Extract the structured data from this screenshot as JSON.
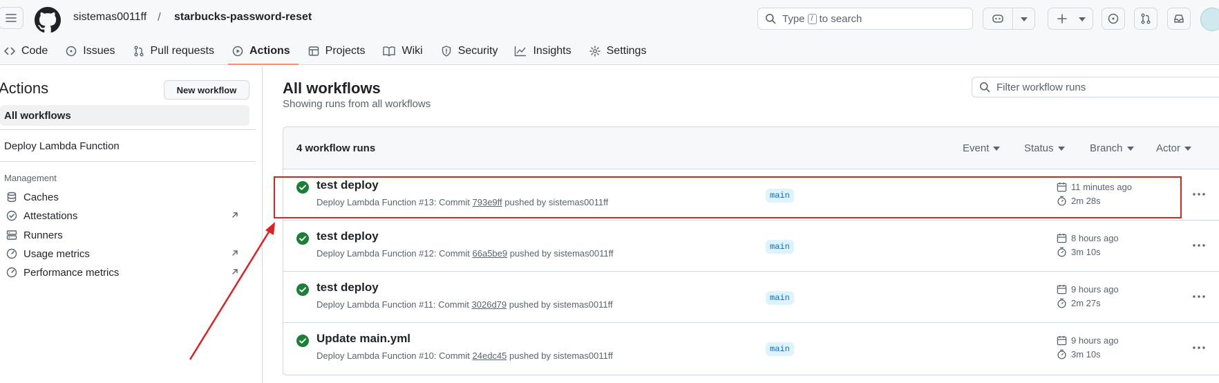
{
  "header": {
    "owner": "sistemas0011ff",
    "separator": "/",
    "repo": "starbucks-password-reset",
    "search": {
      "prefix": "Type",
      "key": "/",
      "suffix": "to search"
    }
  },
  "repo_nav": {
    "tabs": [
      {
        "label": "Code",
        "icon": "code-icon"
      },
      {
        "label": "Issues",
        "icon": "issue-opened-icon"
      },
      {
        "label": "Pull requests",
        "icon": "git-pull-request-icon"
      },
      {
        "label": "Actions",
        "icon": "play-icon",
        "active": true
      },
      {
        "label": "Projects",
        "icon": "table-icon"
      },
      {
        "label": "Wiki",
        "icon": "book-icon"
      },
      {
        "label": "Security",
        "icon": "shield-icon"
      },
      {
        "label": "Insights",
        "icon": "graph-icon"
      },
      {
        "label": "Settings",
        "icon": "gear-icon"
      }
    ]
  },
  "sidebar": {
    "title": "Actions",
    "new_workflow": "New workflow",
    "all_workflows": "All workflows",
    "workflows": [
      "Deploy Lambda Function"
    ],
    "management_heading": "Management",
    "management": [
      {
        "label": "Caches",
        "icon": "database-icon",
        "external": false
      },
      {
        "label": "Attestations",
        "icon": "verified-icon",
        "external": true
      },
      {
        "label": "Runners",
        "icon": "server-icon",
        "external": false
      },
      {
        "label": "Usage metrics",
        "icon": "meter-icon",
        "external": true
      },
      {
        "label": "Performance metrics",
        "icon": "meter-icon",
        "external": true
      }
    ]
  },
  "main": {
    "title": "All workflows",
    "subtitle": "Showing runs from all workflows",
    "filter_placeholder": "Filter workflow runs",
    "run_count": "4 workflow runs",
    "filters": [
      "Event",
      "Status",
      "Branch",
      "Actor"
    ],
    "runs": [
      {
        "title": "test deploy",
        "workflow": "Deploy Lambda Function",
        "number": "#13",
        "commit_label": "Commit",
        "sha": "793e9ff",
        "pushed_by": "pushed by sistemas0011ff",
        "branch": "main",
        "when": "11 minutes ago",
        "duration": "2m 28s",
        "status": "success"
      },
      {
        "title": "test deploy",
        "workflow": "Deploy Lambda Function",
        "number": "#12",
        "commit_label": "Commit",
        "sha": "66a5be9",
        "pushed_by": "pushed by sistemas0011ff",
        "branch": "main",
        "when": "8 hours ago",
        "duration": "3m 10s",
        "status": "success"
      },
      {
        "title": "test deploy",
        "workflow": "Deploy Lambda Function",
        "number": "#11",
        "commit_label": "Commit",
        "sha": "3026d79",
        "pushed_by": "pushed by sistemas0011ff",
        "branch": "main",
        "when": "9 hours ago",
        "duration": "2m 27s",
        "status": "success"
      },
      {
        "title": "Update main.yml",
        "workflow": "Deploy Lambda Function",
        "number": "#10",
        "commit_label": "Commit",
        "sha": "24edc45",
        "pushed_by": "pushed by sistemas0011ff",
        "branch": "main",
        "when": "9 hours ago",
        "duration": "3m 10s",
        "status": "success"
      }
    ]
  },
  "colors": {
    "success": "#1a7f37",
    "accent_underline": "#fd8c73",
    "annotation": "#e02020",
    "branch_bg": "#ddf4ff",
    "branch_fg": "#0969da"
  }
}
